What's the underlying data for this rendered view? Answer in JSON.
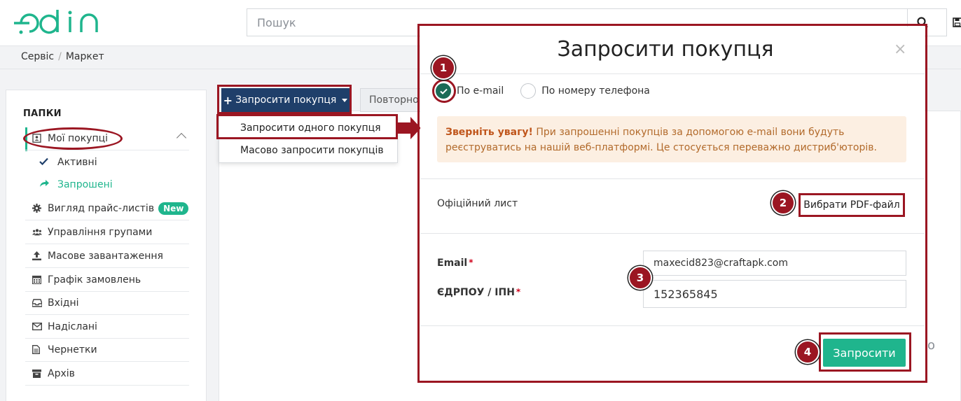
{
  "header": {
    "logo_text": "edin",
    "search_placeholder": "Пошук"
  },
  "breadcrumb": [
    "Сервіс",
    "Маркет"
  ],
  "sidebar": {
    "title": "ПАПКИ",
    "my_buyers": "Мої покупці",
    "sub_items": [
      {
        "label": "Активні",
        "icon": "check-icon"
      },
      {
        "label": "Запрошені",
        "icon": "share-arrow-icon"
      }
    ],
    "items": [
      {
        "label": "Вигляд прайс-листів",
        "icon": "gear-icon",
        "badge": "New"
      },
      {
        "label": "Управління групами",
        "icon": "users-icon"
      },
      {
        "label": "Масове завантаження",
        "icon": "upload-icon"
      },
      {
        "label": "Графік замовлень",
        "icon": "calendar-icon"
      },
      {
        "label": "Вхідні",
        "icon": "inbox-icon"
      },
      {
        "label": "Надіслані",
        "icon": "envelope-icon"
      },
      {
        "label": "Чернетки",
        "icon": "draft-icon"
      },
      {
        "label": "Архів",
        "icon": "archive-icon"
      }
    ]
  },
  "toolbar": {
    "invite_button": "Запросити покупця",
    "repeat_button": "Повторно"
  },
  "dropdown": {
    "items": [
      "Запросити одного покупця",
      "Масово запросити покупців"
    ]
  },
  "background_fragment": "о",
  "modal": {
    "title": "Запросити покупця",
    "close": "×",
    "radio_email": "По e-mail",
    "radio_phone": "По номеру телефона",
    "alert_bold": "Зверніть увагу!",
    "alert_text": " При запрошенні покупців за допомогою e-mail вони будуть реєструватись на нашій веб-платформі. Це стосується переважно дистриб'юторів.",
    "letter_label": "Офіційний лист",
    "pdf_button": "Вибрати PDF-файл",
    "email_label": "Email",
    "email_value": "maxecid823@craftapk.com",
    "edrpou_label": "ЄДРПОУ / ІПН",
    "edrpou_value": "152365845",
    "required_mark": "*",
    "submit": "Запросити"
  },
  "steps": [
    "1",
    "2",
    "3",
    "4"
  ],
  "colors": {
    "accent_green": "#1fb58d",
    "navy": "#1f3f6a",
    "annotation_red": "#9b1622"
  }
}
